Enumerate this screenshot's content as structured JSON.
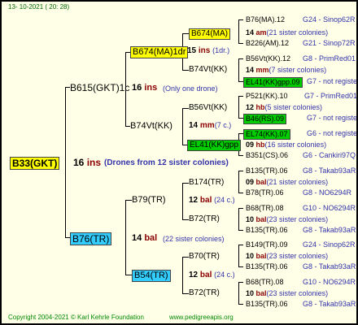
{
  "header_date": "13- 10-2021 ( 20: 28)",
  "root": {
    "name": "B33(GKT)",
    "gen_num": "16",
    "gen_unit": "ins",
    "note": "(Drones from 12 sister colonies)"
  },
  "a": {
    "name": "B615(GKT)1c",
    "gen_num": "16",
    "gen_unit": "ins",
    "note": "(Only one drone)"
  },
  "aa": {
    "name": "B674(MA)1dr",
    "gen_num": "15",
    "gen_unit": "ins",
    "note": "(1dr.)"
  },
  "aaa": {
    "name": "B674(MA)",
    "gen_num": "14",
    "gen_unit": "am",
    "note": "(21 sister colonies)"
  },
  "aaa1": {
    "name": "B76(MA).12",
    "code": "G24 - Sinop62R"
  },
  "aaa2": {
    "name": "B226(AM).12",
    "code": "G21 - Sinop72R"
  },
  "aab": {
    "name": "B74Vt(KK)",
    "gen_num": "14",
    "gen_unit": "mm",
    "note": "(7 sister colonies)"
  },
  "aab1": {
    "name": "B56Vt(KK).12",
    "code": "G8 - PrimRed01"
  },
  "aab2": {
    "name": "EL41(KK)gpp.09",
    "code": "G7 - not registe"
  },
  "ab": {
    "name": "B74Vt(KK)",
    "gen_num": "14",
    "gen_unit": "mm",
    "note": "(7 c.)"
  },
  "aba": {
    "name": "B56Vt(KK)",
    "gen_num": "12",
    "gen_unit": "hb",
    "note": "(5 sister colonies)"
  },
  "aba1": {
    "name": "P521(KK).10",
    "code": "G7 - PrimRed01"
  },
  "aba2": {
    "name": "B46(RS).09",
    "code": "G7 - not registe"
  },
  "abb": {
    "name": "EL41(KK)gpp",
    "gen_num": "09",
    "gen_unit": "hb",
    "note": "(16 sister colonies)"
  },
  "abb1": {
    "name": "EL74(KK).07",
    "code": "G6 - not registe"
  },
  "abb2": {
    "name": "B351(CS).06",
    "code": "G6 - Cankiri97Q"
  },
  "b": {
    "name": "B76(TR)",
    "gen_num": "14",
    "gen_unit": "bal",
    "note": "(22 sister colonies)"
  },
  "ba": {
    "name": "B79(TR)",
    "gen_num": "12",
    "gen_unit": "bal",
    "note": "(24 c.)"
  },
  "baa": {
    "name": "B174(TR)",
    "gen_num": "09",
    "gen_unit": "bal",
    "note": "(21 sister colonies)"
  },
  "baa1": {
    "name": "B135(TR).06",
    "code": "G8 - Takab93aR"
  },
  "baa2": {
    "name": "B78(TR).06",
    "code": "G8 - NO6294R"
  },
  "bab": {
    "name": "B72(TR)",
    "gen_num": "10",
    "gen_unit": "bal",
    "note": "(23 sister colonies)"
  },
  "bab1": {
    "name": "B68(TR).08",
    "code": "G10 - NO6294R"
  },
  "bab2": {
    "name": "B135(TR).06",
    "code": "G8 - Takab93aR"
  },
  "bb": {
    "name": "B54(TR)",
    "gen_num": "12",
    "gen_unit": "bal",
    "note": "(24 c.)"
  },
  "bba": {
    "name": "B70(TR)",
    "gen_num": "10",
    "gen_unit": "bal",
    "note": "(23 sister colonies)"
  },
  "bba1": {
    "name": "B149(TR).09",
    "code": "G24 - Sinop62R"
  },
  "bba2": {
    "name": "B135(TR).06",
    "code": "G8 - Takab93aR"
  },
  "bbb": {
    "name": "B72(TR)",
    "gen_num": "10",
    "gen_unit": "bal",
    "note": "(23 sister colonies)"
  },
  "bbb1": {
    "name": "B68(TR).08",
    "code": "G10 - NO6294R"
  },
  "bbb2": {
    "name": "B135(TR).06",
    "code": "G8 - Takab93aR"
  },
  "footer": {
    "copyright": "Copyright 2004-2021 © Karl Kehrle Foundation",
    "site": "www.pedigreeapis.org"
  }
}
